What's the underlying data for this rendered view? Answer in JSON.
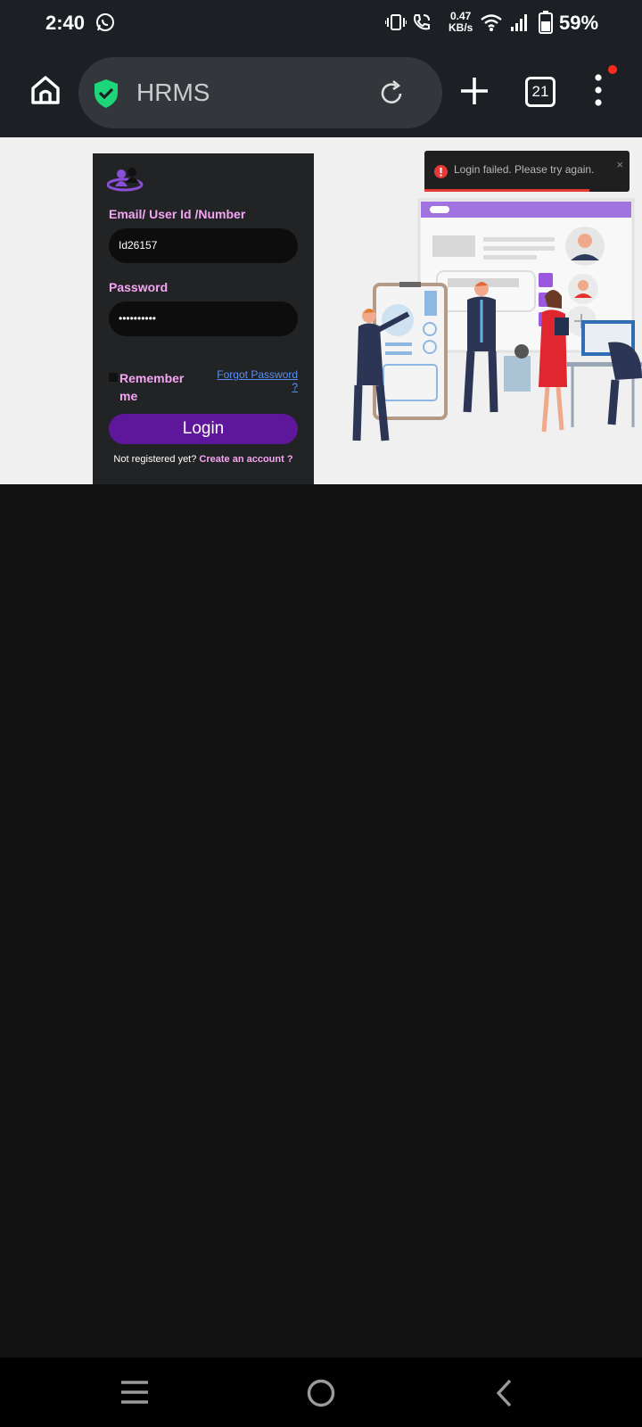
{
  "status_bar": {
    "time": "2:40",
    "net_speed_value": "0.47",
    "net_speed_unit": "KB/s",
    "battery_percent": "59%"
  },
  "browser": {
    "omnibox_text": "HRMS",
    "tab_count": "21"
  },
  "login_form": {
    "email_label": "Email/ User Id /Number",
    "email_value": "Id26157",
    "password_label": "Password",
    "password_value": "••••••••••",
    "remember_label": "Remember me",
    "forgot_label": "Forgot Password ?",
    "login_button": "Login",
    "not_registered": "Not registered yet?",
    "create_account": "Create an account ?"
  },
  "toast": {
    "message": "Login failed. Please try again.",
    "close": "×"
  },
  "colors": {
    "accent_purple": "#5e169a",
    "label_pink": "#f4a6f4",
    "link_blue": "#5a8ff0",
    "error_red": "#e53935",
    "secure_green": "#1ed67a"
  }
}
